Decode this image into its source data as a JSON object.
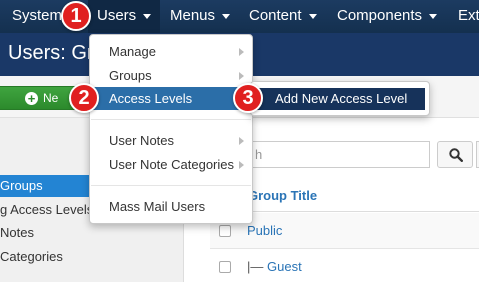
{
  "topbar": {
    "menus": [
      {
        "label": "System"
      },
      {
        "label": "Users"
      },
      {
        "label": "Menus"
      },
      {
        "label": "Content"
      },
      {
        "label": "Components"
      },
      {
        "label": "Ext"
      }
    ]
  },
  "page": {
    "title": "Users: Gr"
  },
  "toolbar": {
    "new_label": "Ne"
  },
  "sidebar": {
    "items": [
      {
        "label": "Groups",
        "active": true
      },
      {
        "label": "g Access Levels"
      },
      {
        "label": "Notes"
      },
      {
        "label": "Categories"
      }
    ]
  },
  "search": {
    "placeholder": "h"
  },
  "table": {
    "column_title": "Group Title",
    "rows": [
      {
        "prefix": "",
        "name": "Public"
      },
      {
        "prefix": "|— ",
        "name": "Guest"
      }
    ]
  },
  "dropdown": {
    "items": [
      {
        "label": "Manage"
      },
      {
        "label": "Groups"
      },
      {
        "label": "Access Levels"
      },
      {
        "label": "User Notes"
      },
      {
        "label": "User Note Categories"
      },
      {
        "label": "Mass Mail Users"
      }
    ]
  },
  "submenu": {
    "label": "Add New Access Level"
  },
  "badges": [
    "1",
    "2",
    "3"
  ],
  "colors": {
    "topbar": "#1c3b61",
    "title_bar": "#1a3867",
    "highlight": "#2b6ea8",
    "submenu_highlight": "#16325a",
    "badge": "#e02020",
    "new_button": "#2c8a2c",
    "link": "#2a74b6",
    "sidebar_active": "#2384d3"
  }
}
